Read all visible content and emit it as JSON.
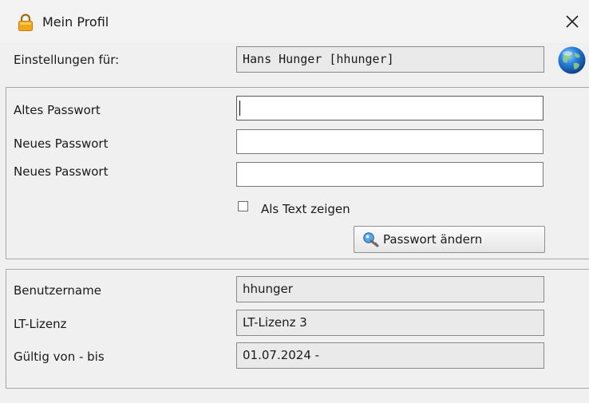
{
  "window": {
    "title": "Mein Profil"
  },
  "header": {
    "settings_for_label": "Einstellungen für:",
    "settings_for_value": "Hans Hunger [hhunger]"
  },
  "password": {
    "old_label": "Altes Passwort",
    "new_label": "Neues Passwort",
    "repeat_label": "Neues Passwort",
    "old_value": "",
    "new_value": "",
    "repeat_value": "",
    "show_text_label": "Als Text zeigen",
    "show_text_checked": false,
    "change_button_label": "Passwort ändern"
  },
  "info": {
    "username_label": "Benutzername",
    "username_value": "hhunger",
    "license_label": "LT-Lizenz",
    "license_value": "LT-Lizenz 3",
    "valid_label": "Gültig von - bis",
    "valid_value": "01.07.2024 -"
  },
  "icons": {
    "title_icon": "lock-icon",
    "close_icon": "close-icon",
    "user_icon": "globe-icon",
    "button_icon": "key-icon"
  },
  "colors": {
    "background": "#f0f0f0",
    "field_readonly": "#eaeaea",
    "input_bg": "#ffffff",
    "lock_orange": "#f2a71b",
    "globe_blue": "#1e6fd0"
  }
}
